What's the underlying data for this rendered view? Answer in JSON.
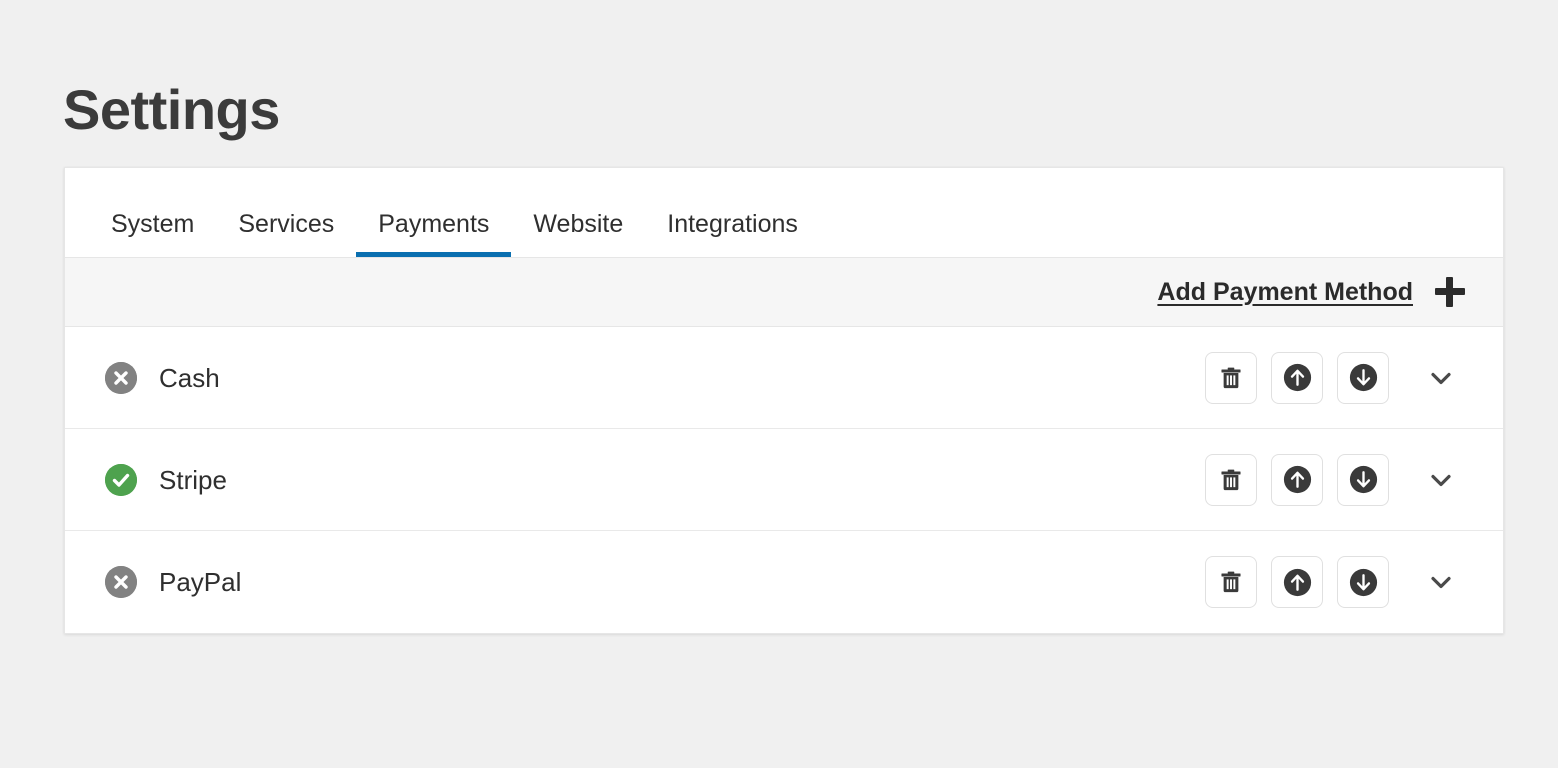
{
  "page": {
    "title": "Settings",
    "background_color": "#f0f0f0"
  },
  "colors": {
    "accent": "#0a6fb0",
    "enabled": "#4ea24e",
    "disabled": "#828282",
    "text": "#2f2f2f",
    "card_background": "#ffffff",
    "toolbar_background": "#f6f6f6"
  },
  "tabs": [
    {
      "label": "System",
      "active": false
    },
    {
      "label": "Services",
      "active": false
    },
    {
      "label": "Payments",
      "active": true
    },
    {
      "label": "Website",
      "active": false
    },
    {
      "label": "Integrations",
      "active": false
    }
  ],
  "toolbar": {
    "add_label": "Add Payment Method",
    "add_icon": "plus-icon"
  },
  "actions": {
    "delete_icon": "trash-icon",
    "move_up_icon": "arrow-up-circle-icon",
    "move_down_icon": "arrow-down-circle-icon",
    "expand_icon": "chevron-down-icon"
  },
  "payment_methods": [
    {
      "name": "Cash",
      "status": "disabled",
      "status_icon": "circle-x-icon"
    },
    {
      "name": "Stripe",
      "status": "enabled",
      "status_icon": "circle-check-icon"
    },
    {
      "name": "PayPal",
      "status": "disabled",
      "status_icon": "circle-x-icon"
    }
  ]
}
